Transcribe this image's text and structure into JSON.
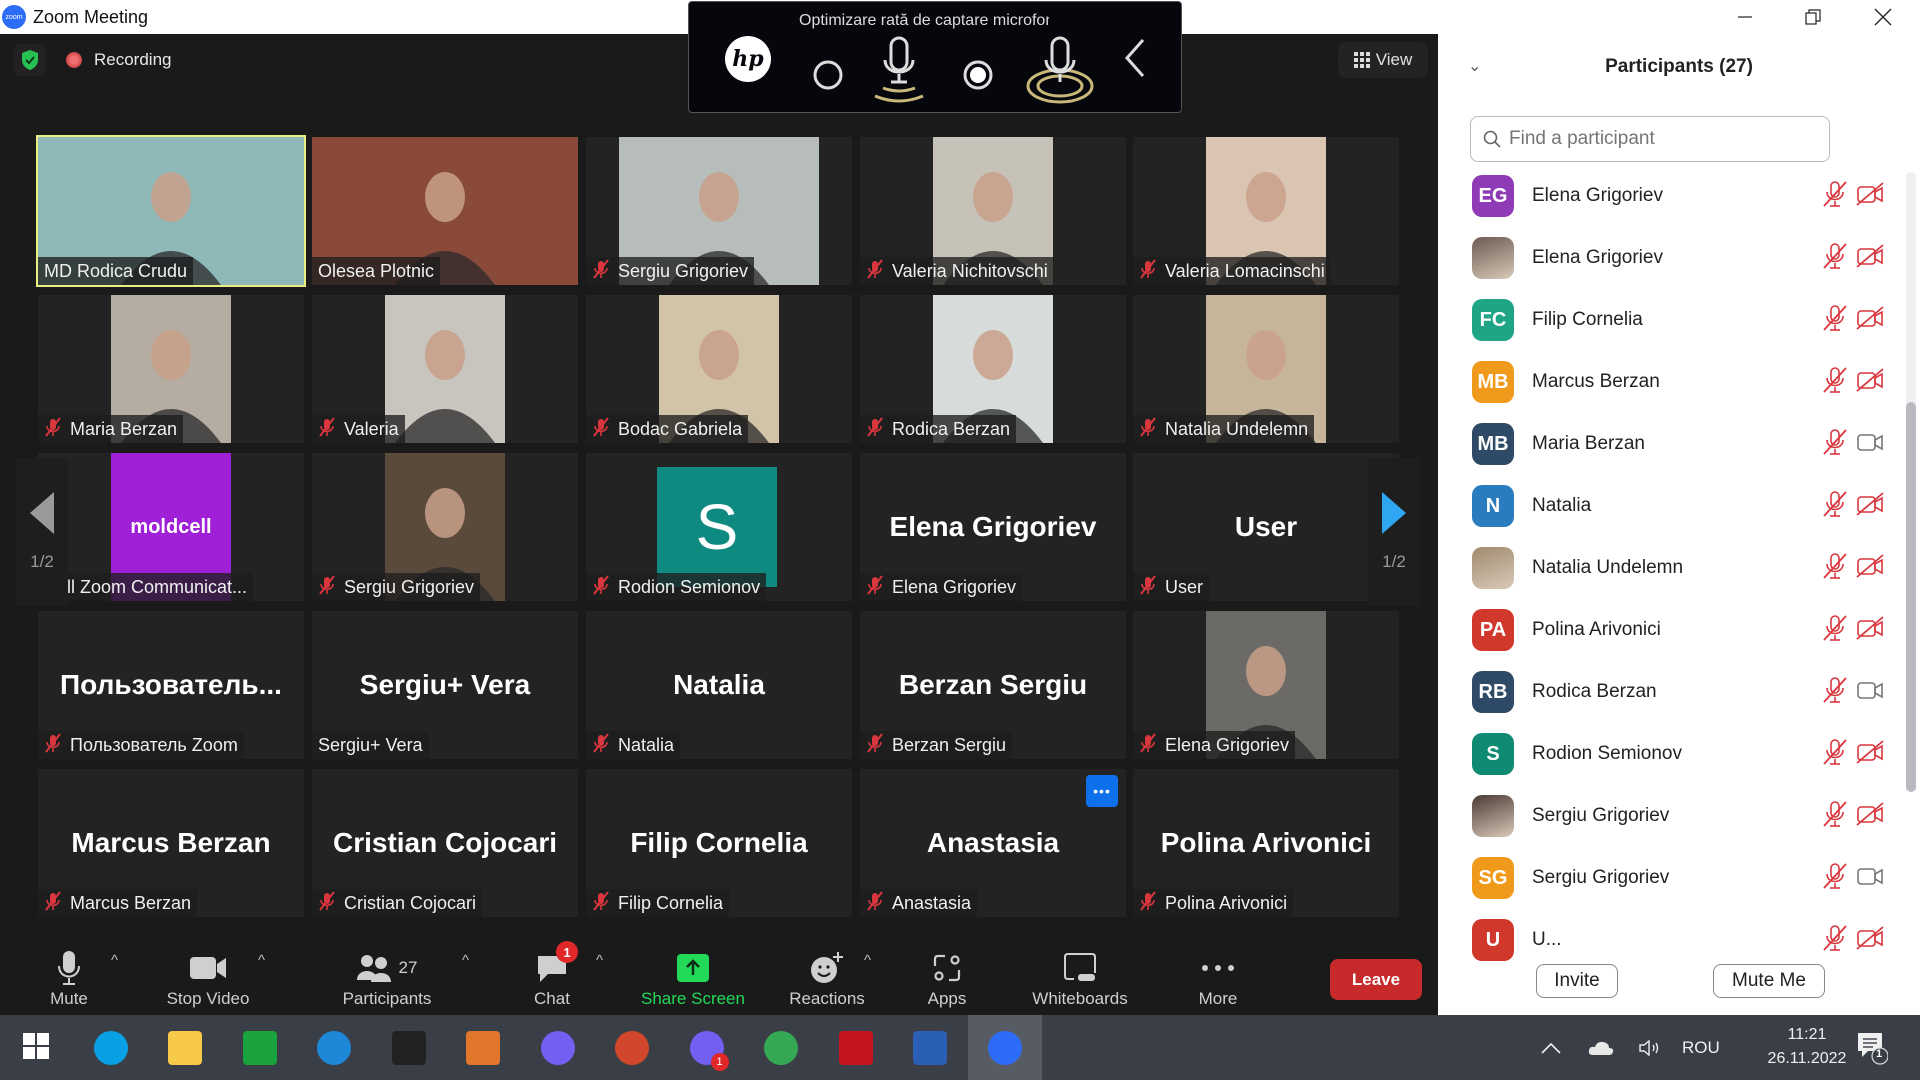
{
  "window": {
    "title": "Zoom Meeting",
    "app_icon": "zoom-logo",
    "controls": [
      "minimize",
      "restore",
      "close"
    ]
  },
  "meeting_header": {
    "security_icon": "shield-check-icon",
    "recording_label": "Recording",
    "view_label": "View"
  },
  "hp_overlay": {
    "caption": "Optimizare rată de captare microfon",
    "options": [
      "standard-mic-option",
      "enhanced-mic-option"
    ],
    "selected": "enhanced-mic-option"
  },
  "grid": {
    "page_indicator_left": "1/2",
    "page_indicator_right": "1/2",
    "tiles": [
      {
        "label": "MD Rodica Crudu",
        "muted": false,
        "video": true,
        "active_speaker": true,
        "bg": "#8fb9b8"
      },
      {
        "label": "Olesea Plotnic",
        "muted": false,
        "video": true,
        "bg": "#8a4a3a"
      },
      {
        "label": "Sergiu Grigoriev",
        "muted": true,
        "video": true,
        "bg": "#b7bdbb"
      },
      {
        "label": "Valeria Nichitovschi",
        "muted": true,
        "video": true,
        "bg": "#c7c2b8"
      },
      {
        "label": "Valeria Lomacinschi",
        "muted": true,
        "video": true,
        "bg": "#d9c5b2"
      },
      {
        "label": "Maria Berzan",
        "muted": true,
        "video": true,
        "bg": "#b5ada2"
      },
      {
        "label": "Valeria",
        "muted": true,
        "video": true,
        "bg": "#c8c4be"
      },
      {
        "label": "Bodac Gabriela",
        "muted": true,
        "video": true,
        "bg": "#d2c4a8"
      },
      {
        "label": "Rodica Berzan",
        "muted": true,
        "video": true,
        "bg": "#d7dbd9"
      },
      {
        "label": "Natalia Undelemn",
        "muted": true,
        "video": true,
        "bg": "#c7b59b"
      },
      {
        "label": "lcell Zoom Communicat...",
        "muted": false,
        "video": true,
        "bg": "#a020d8",
        "logo_text": "moldcell"
      },
      {
        "label": "Sergiu Grigoriev",
        "muted": true,
        "video": true,
        "bg": "#5a4a3c"
      },
      {
        "label": "Rodion Semionov",
        "muted": true,
        "video": false,
        "avatar_letter": "S",
        "bg": "#0f8a80"
      },
      {
        "label": "Elena Grigoriev",
        "muted": true,
        "video": false,
        "big_name": "Elena Grigoriev"
      },
      {
        "label": "User",
        "muted": true,
        "video": false,
        "big_name": "User"
      },
      {
        "label": "Пользователь Zoom",
        "muted": true,
        "video": false,
        "big_name": "Пользователь..."
      },
      {
        "label": "Sergiu+ Vera",
        "muted": false,
        "video": false,
        "big_name": "Sergiu+ Vera"
      },
      {
        "label": "Natalia",
        "muted": true,
        "video": false,
        "big_name": "Natalia"
      },
      {
        "label": "Berzan Sergiu",
        "muted": true,
        "video": false,
        "big_name": "Berzan Sergiu"
      },
      {
        "label": "Elena Grigoriev",
        "muted": true,
        "video": true,
        "bg": "#6b6a66"
      },
      {
        "label": "Marcus Berzan",
        "muted": true,
        "video": false,
        "big_name": "Marcus Berzan"
      },
      {
        "label": "Cristian Cojocari",
        "muted": true,
        "video": false,
        "big_name": "Cristian Cojocari"
      },
      {
        "label": "Filip Cornelia",
        "muted": true,
        "video": false,
        "big_name": "Filip Cornelia"
      },
      {
        "label": "Anastasia",
        "muted": true,
        "video": false,
        "big_name": "Anastasia",
        "has_more_button": true
      },
      {
        "label": "Polina Arivonici",
        "muted": true,
        "video": false,
        "big_name": "Polina Arivonici"
      }
    ]
  },
  "toolbar": {
    "mute_label": "Mute",
    "stop_video_label": "Stop Video",
    "participants_label": "Participants",
    "participants_count": "27",
    "chat_label": "Chat",
    "chat_badge": "1",
    "share_screen_label": "Share Screen",
    "reactions_label": "Reactions",
    "apps_label": "Apps",
    "whiteboards_label": "Whiteboards",
    "more_label": "More",
    "leave_label": "Leave"
  },
  "colors": {
    "share_green": "#23d959",
    "leave_red": "#c72a2a",
    "muted_red": "#d9363e",
    "active_speaker_border": "#e9ee80",
    "next_page_blue": "#2ea6f2"
  },
  "participants_panel": {
    "title": "Participants (27)",
    "search_placeholder": "Find a participant",
    "invite_label": "Invite",
    "mute_me_label": "Mute Me",
    "items": [
      {
        "name": "Elena Grigoriev",
        "initials": "EG",
        "color": "#8e3bb5",
        "mic_muted": true,
        "video_off": true
      },
      {
        "name": "Elena Grigoriev",
        "initials": "",
        "photo": true,
        "color": "#6b5a50",
        "mic_muted": true,
        "video_off": true
      },
      {
        "name": "Filip Cornelia",
        "initials": "FC",
        "color": "#1fa486",
        "mic_muted": true,
        "video_off": true
      },
      {
        "name": "Marcus Berzan",
        "initials": "MB",
        "color": "#f09a1c",
        "mic_muted": true,
        "video_off": true
      },
      {
        "name": "Maria Berzan",
        "initials": "MB",
        "color": "#2f4a66",
        "mic_muted": true,
        "video_off": false
      },
      {
        "name": "Natalia",
        "initials": "N",
        "color": "#2b7bbf",
        "mic_muted": true,
        "video_off": true
      },
      {
        "name": "Natalia Undelemn",
        "initials": "",
        "photo": true,
        "color": "#a08a6e",
        "mic_muted": true,
        "video_off": true
      },
      {
        "name": "Polina Arivonici",
        "initials": "PA",
        "color": "#d0382c",
        "mic_muted": true,
        "video_off": true
      },
      {
        "name": "Rodica Berzan",
        "initials": "RB",
        "color": "#2f4a66",
        "mic_muted": true,
        "video_off": false
      },
      {
        "name": "Rodion Semionov",
        "initials": "S",
        "color": "#0f8a73",
        "mic_muted": true,
        "video_off": true
      },
      {
        "name": "Sergiu Grigoriev",
        "initials": "",
        "photo": true,
        "color": "#4a3a35",
        "mic_muted": true,
        "video_off": true
      },
      {
        "name": "Sergiu Grigoriev",
        "initials": "SG",
        "color": "#f09a1c",
        "mic_muted": true,
        "video_off": false
      },
      {
        "name": "U...",
        "initials": "U",
        "color": "#d0382c",
        "mic_muted": true,
        "video_off": true
      }
    ]
  },
  "taskbar": {
    "apps": [
      {
        "name": "windows-start",
        "color": "#ffffff"
      },
      {
        "name": "skype",
        "color": "#0aa1e4"
      },
      {
        "name": "file-explorer",
        "color": "#f7c948"
      },
      {
        "name": "moldova-app-green",
        "color": "#1aa33c"
      },
      {
        "name": "edge",
        "color": "#1e88d8"
      },
      {
        "name": "scanner-app",
        "color": "#222222"
      },
      {
        "name": "moldova-app-orange",
        "color": "#e2762a"
      },
      {
        "name": "viber",
        "color": "#7360f2"
      },
      {
        "name": "powerpoint",
        "color": "#d2472b"
      },
      {
        "name": "viber-badge",
        "color": "#7360f2",
        "badge": "1"
      },
      {
        "name": "chrome",
        "color": "#34a853"
      },
      {
        "name": "acrobat",
        "color": "#c4161c"
      },
      {
        "name": "word",
        "color": "#2b5eb5"
      },
      {
        "name": "zoom",
        "color": "#2d6cf6",
        "active": true
      }
    ],
    "tray": {
      "language": "ROU",
      "time": "11:21",
      "date": "26.11.2022",
      "notifications_count": "1"
    }
  }
}
